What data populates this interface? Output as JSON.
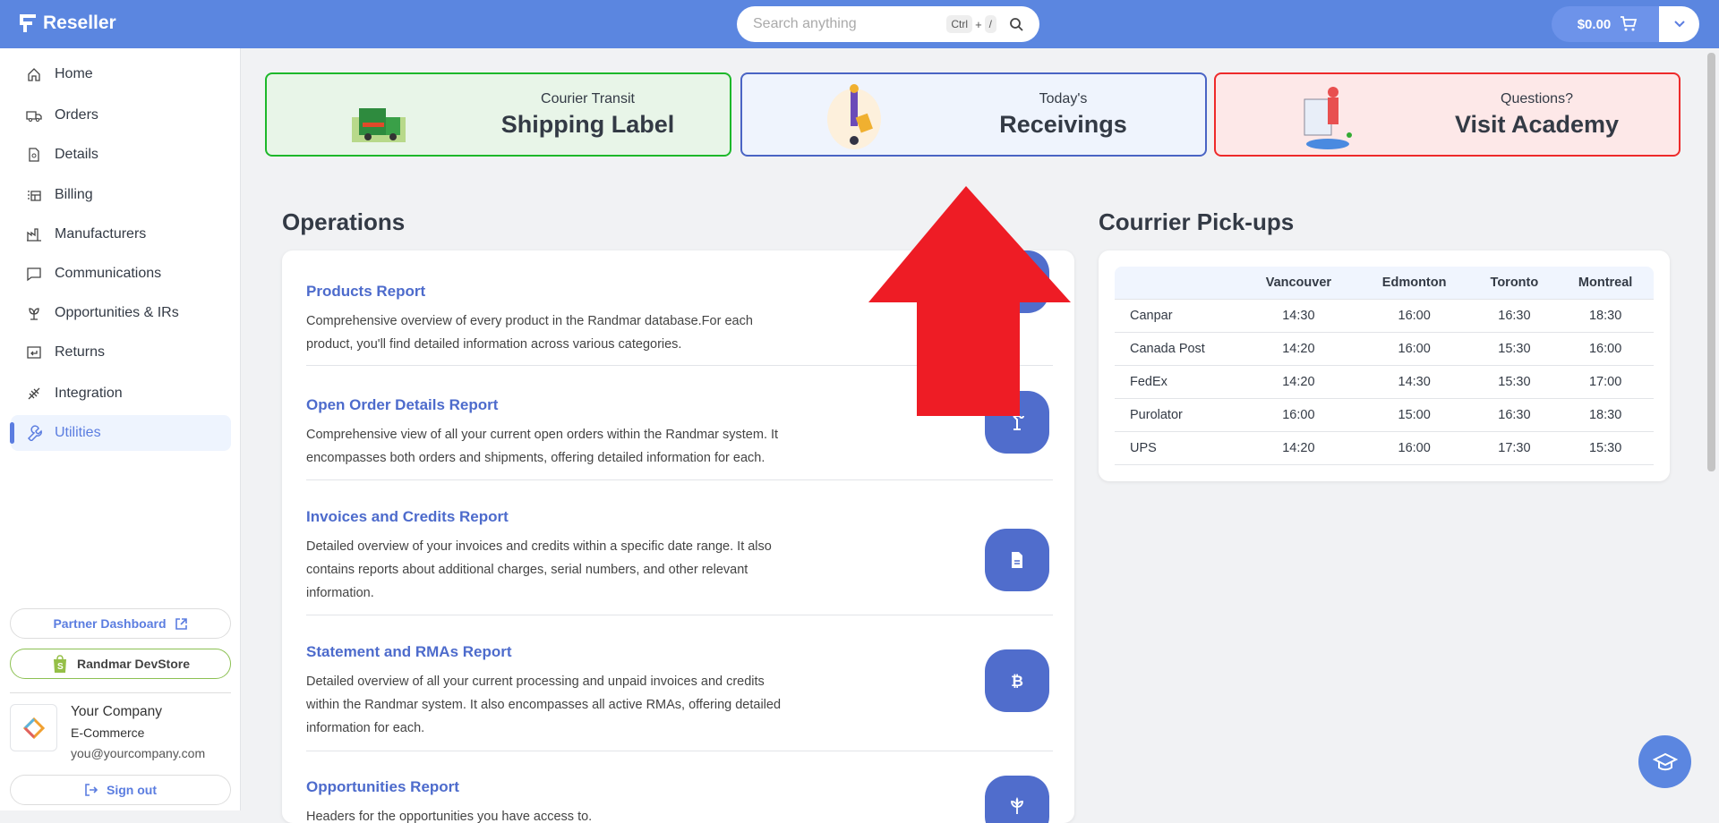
{
  "header": {
    "app_name": "Reseller",
    "search_placeholder": "Search anything",
    "shortcut_ctrl": "Ctrl",
    "shortcut_plus": "+",
    "shortcut_key": "/",
    "cart_total": "$0.00"
  },
  "sidebar": {
    "items": [
      {
        "label": "Home",
        "icon": "home-icon"
      },
      {
        "label": "Orders",
        "icon": "truck-icon"
      },
      {
        "label": "Details",
        "icon": "document-search-icon"
      },
      {
        "label": "Billing",
        "icon": "billing-icon"
      },
      {
        "label": "Manufacturers",
        "icon": "factory-icon"
      },
      {
        "label": "Communications",
        "icon": "chat-icon"
      },
      {
        "label": "Opportunities & IRs",
        "icon": "plant-icon"
      },
      {
        "label": "Returns",
        "icon": "return-icon"
      },
      {
        "label": "Integration",
        "icon": "plug-icon"
      },
      {
        "label": "Utilities",
        "icon": "wrench-icon",
        "active": true
      }
    ],
    "partner_dashboard": "Partner Dashboard",
    "devstore": "Randmar DevStore",
    "company": {
      "name": "Your Company",
      "type": "E-Commerce",
      "email": "you@yourcompany.com"
    },
    "sign_out": "Sign out"
  },
  "cards": [
    {
      "small": "Courier Transit",
      "big": "Shipping Label",
      "border": "#1db82a",
      "bg": "#e8f5e8"
    },
    {
      "small": "Today's",
      "big": "Receivings",
      "border": "#4a64c4",
      "bg": "#eff4fd"
    },
    {
      "small": "Questions?",
      "big": "Visit Academy",
      "border": "#ee2a2a",
      "bg": "#fde8e8"
    }
  ],
  "operations": {
    "title": "Operations",
    "reports": [
      {
        "title": "Products Report",
        "desc": "Comprehensive overview of every product in the Randmar database.For each product, you'll find detailed information across various categories.",
        "icon": "box-icon"
      },
      {
        "title": "Open Order Details Report",
        "desc": "Comprehensive view of all your current open orders within the Randmar system. It encompasses both orders and shipments, offering detailed information for each.",
        "icon": "crane-icon"
      },
      {
        "title": "Invoices and Credits Report",
        "desc": "Detailed overview of your invoices and credits within a specific date range. It also contains reports about additional charges, serial numbers, and other relevant information.",
        "icon": "file-icon"
      },
      {
        "title": "Statement and RMAs Report",
        "desc": "Detailed overview of all your current processing and unpaid invoices and credits within the Randmar system. It also encompasses all active RMAs, offering detailed information for each.",
        "icon": "bitcoin-icon"
      },
      {
        "title": "Opportunities Report",
        "desc": "Headers for the opportunities you have access to.",
        "icon": "plant-icon"
      }
    ]
  },
  "pickups": {
    "title": "Courrier Pick-ups",
    "columns": [
      "",
      "Vancouver",
      "Edmonton",
      "Toronto",
      "Montreal"
    ],
    "rows": [
      [
        "Canpar",
        "14:30",
        "16:00",
        "16:30",
        "18:30"
      ],
      [
        "Canada Post",
        "14:20",
        "16:00",
        "15:30",
        "16:00"
      ],
      [
        "FedEx",
        "14:20",
        "14:30",
        "15:30",
        "17:00"
      ],
      [
        "Purolator",
        "16:00",
        "15:00",
        "16:30",
        "18:30"
      ],
      [
        "UPS",
        "14:20",
        "16:00",
        "17:30",
        "15:30"
      ]
    ]
  },
  "annotation": {
    "arrow_color": "#ee1c25"
  }
}
